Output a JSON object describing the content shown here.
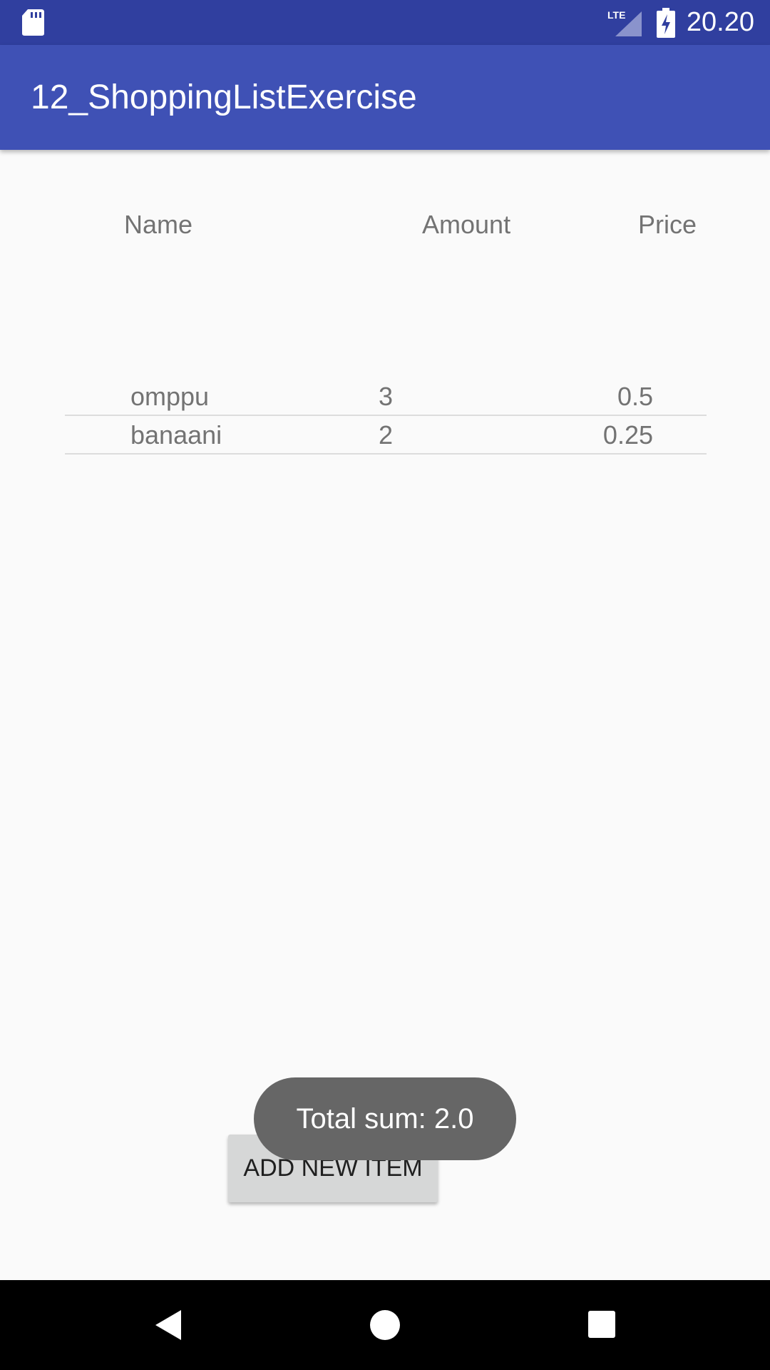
{
  "status_bar": {
    "time": "20.20",
    "network_label": "LTE",
    "icons": [
      "sd-card-icon",
      "lte-signal-icon",
      "battery-charging-icon"
    ]
  },
  "app_bar": {
    "title": "12_ShoppingListExercise",
    "color": "#3f51b5"
  },
  "table": {
    "headers": {
      "name": "Name",
      "amount": "Amount",
      "price": "Price"
    },
    "rows": [
      {
        "name": "omppu",
        "amount": "3",
        "price": "0.5"
      },
      {
        "name": "banaani",
        "amount": "2",
        "price": "0.25"
      }
    ]
  },
  "add_button": {
    "label": "ADD NEW ITEM"
  },
  "toast": {
    "text": "Total sum: 2.0"
  },
  "nav_bar": {
    "icons": [
      "back-icon",
      "home-icon",
      "recents-icon"
    ]
  }
}
